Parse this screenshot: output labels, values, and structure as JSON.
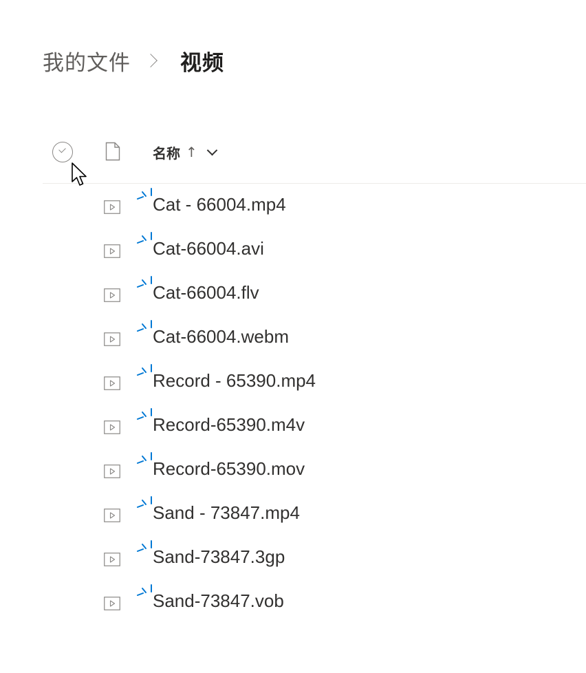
{
  "breadcrumb": {
    "root": "我的文件",
    "current": "视频"
  },
  "header": {
    "name_label": "名称",
    "sort_arrow": "↑",
    "select_all_icon": "circle-check-icon",
    "filetype_icon": "document-icon",
    "dropdown_icon": "chevron-down-icon"
  },
  "files": [
    {
      "name": "Cat - 66004.mp4"
    },
    {
      "name": "Cat-66004.avi"
    },
    {
      "name": "Cat-66004.flv"
    },
    {
      "name": "Cat-66004.webm"
    },
    {
      "name": "Record - 65390.mp4"
    },
    {
      "name": "Record-65390.m4v"
    },
    {
      "name": "Record-65390.mov"
    },
    {
      "name": "Sand - 73847.mp4"
    },
    {
      "name": "Sand-73847.3gp"
    },
    {
      "name": "Sand-73847.vob"
    }
  ],
  "colors": {
    "accent": "#0078d4",
    "text": "#323130",
    "muted": "#605e5c",
    "divider": "#edebe9"
  }
}
